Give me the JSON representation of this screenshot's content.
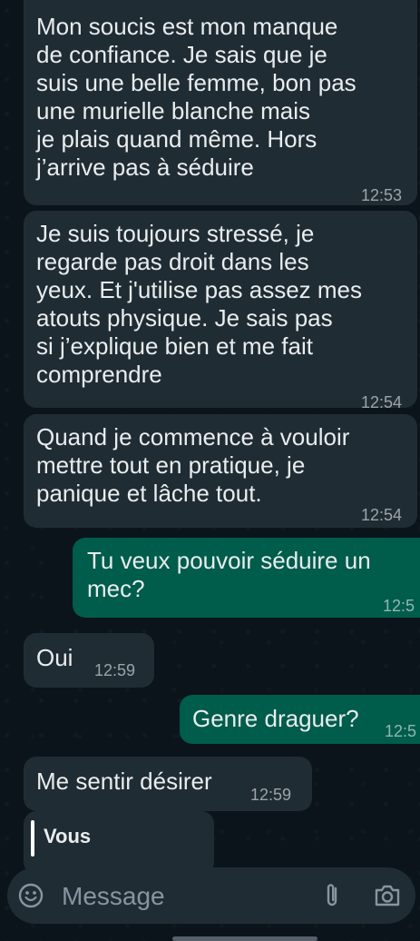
{
  "messages": [
    {
      "direction": "incoming",
      "text": "Mon soucis est mon manque\nde confiance.  Je sais que je\nsuis une belle femme, bon pas\nune murielle blanche mais\nje plais quand même.  Hors\nj’arrive pas à séduire",
      "time": "12:53"
    },
    {
      "direction": "incoming",
      "text": "Je suis toujours stressé, je\nregarde pas droit dans les\nyeux. Et j'utilise pas assez mes\natouts physique.  Je sais pas\nsi j’explique bien et me fait\ncomprendre",
      "time": "12:54"
    },
    {
      "direction": "incoming",
      "text": "Quand je commence à vouloir\nmettre tout en pratique, je\npanique et lâche tout.",
      "time": "12:54"
    },
    {
      "direction": "outgoing",
      "text": "Tu veux pouvoir séduire un\nmec?",
      "time": "12:5"
    },
    {
      "direction": "incoming",
      "text": "Oui",
      "time": "12:59"
    },
    {
      "direction": "outgoing",
      "text": "Genre draguer?",
      "time": "12:5"
    },
    {
      "direction": "incoming",
      "text": "Me sentir désirer",
      "time": "12:59"
    },
    {
      "direction": "incoming",
      "quote_sender": "Vous"
    }
  ],
  "composer": {
    "placeholder": "Message",
    "icons": [
      "emoji-icon",
      "attach-icon",
      "camera-icon"
    ]
  },
  "colors": {
    "background": "#0b141a",
    "incoming_bubble": "#202c33",
    "outgoing_bubble": "#005c4b",
    "composer": "#1f2c34"
  }
}
